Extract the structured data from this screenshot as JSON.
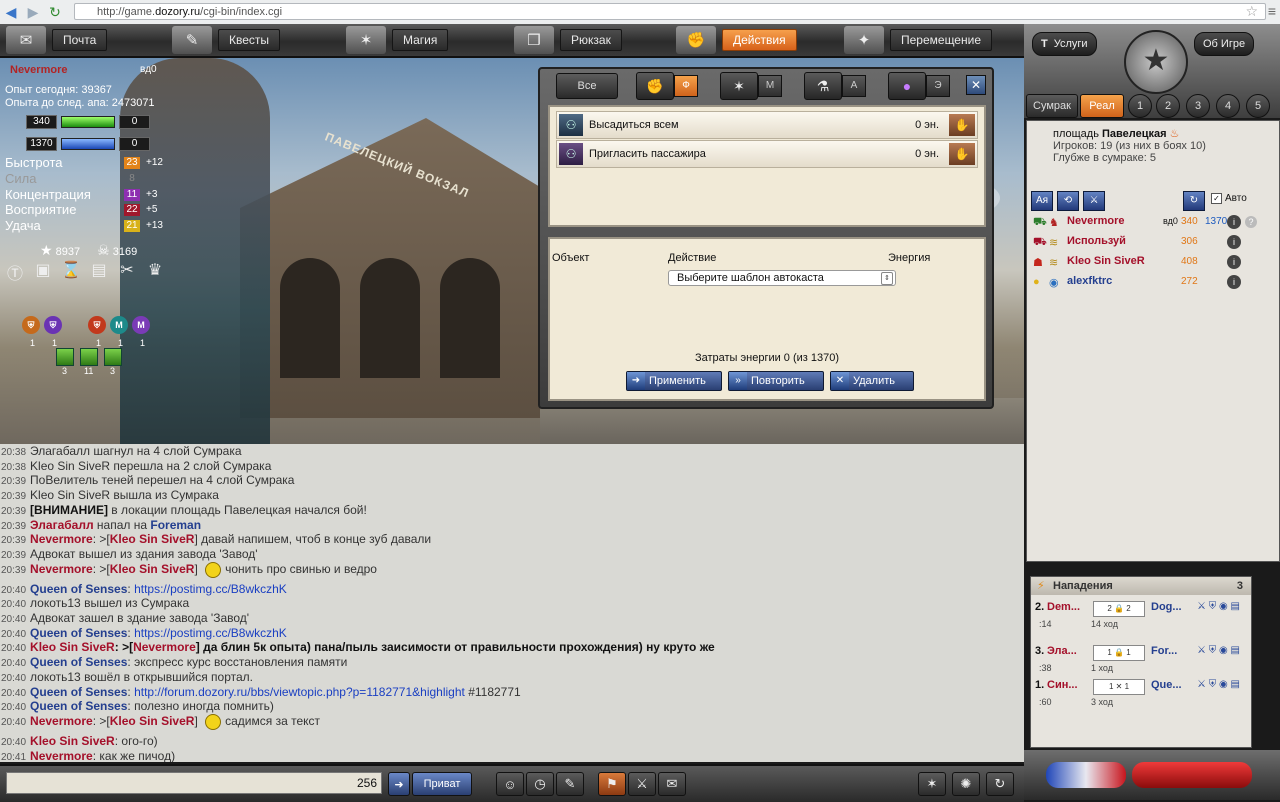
{
  "browser": {
    "url_prefix": "http://game.",
    "url_domain": "dozory.ru",
    "url_path": "/cgi-bin/index.cgi"
  },
  "topmenu": [
    {
      "label": "Почта",
      "icon": "mail-icon"
    },
    {
      "label": "Квесты",
      "icon": "quill-icon"
    },
    {
      "label": "Магия",
      "icon": "magic-icon"
    },
    {
      "label": "Рюкзак",
      "icon": "backpack-icon"
    },
    {
      "label": "Действия",
      "icon": "fist-icon",
      "active": true
    },
    {
      "label": "Перемещение",
      "icon": "compass-icon"
    }
  ],
  "player": {
    "name": "Nevermore",
    "level": "вд0",
    "exp_today": "Опыт сегодня: 39367",
    "exp_next": "Опыта до след. апа: 2473071",
    "hp": "340",
    "hp_extra": "0",
    "mp": "1370",
    "mp_extra": "0",
    "stats": [
      {
        "label": "Быстрота",
        "value": "23",
        "bonus": "+12",
        "color": "#e3841a"
      },
      {
        "label": "Сила",
        "value": "8",
        "bonus": "",
        "color": "#555555",
        "dim": true
      },
      {
        "label": "Концентрация",
        "value": "11",
        "bonus": "+3",
        "color": "#8e2fb1"
      },
      {
        "label": "Восприятие",
        "value": "22",
        "bonus": "+5",
        "color": "#a0182c"
      },
      {
        "label": "Удача",
        "value": "21",
        "bonus": "+13",
        "color": "#d8b21a"
      }
    ],
    "stars": "8937",
    "skulls": "3169",
    "badge_counts": [
      "1",
      "1",
      "1",
      "1",
      "1"
    ],
    "square_counts": [
      "3",
      "11",
      "3"
    ]
  },
  "scene": {
    "sign": "ПАВЕЛЕЦКИЙ ВОКЗАЛ"
  },
  "dialog": {
    "tab_all": "Все",
    "tabs": [
      {
        "icon": "fist-icon",
        "letter": "Ф",
        "active": true
      },
      {
        "icon": "magic-icon",
        "letter": "М"
      },
      {
        "icon": "potion-icon",
        "letter": "А"
      },
      {
        "icon": "orb-icon",
        "letter": "Э"
      }
    ],
    "actions": [
      {
        "label": "Высадиться всем",
        "energy": "0 эн."
      },
      {
        "label": "Пригласить пассажира",
        "energy": "0 эн."
      }
    ],
    "col_object": "Объект",
    "col_action": "Действие",
    "col_energy": "Энергия",
    "select_value": "Выберите шаблон автокаста",
    "energy_cost": "Затраты энергии 0 (из 1370)",
    "buttons": {
      "apply": "Применить",
      "repeat": "Повторить",
      "delete": "Удалить"
    }
  },
  "chat": [
    {
      "time": "20:38",
      "parts": [
        {
          "t": "Элагабалл шагнул на 4 слой Сумрака"
        }
      ]
    },
    {
      "time": "20:38",
      "parts": [
        {
          "t": "Kleo Sin SiveR перешла на 2 слой Сумрака"
        }
      ]
    },
    {
      "time": "20:39",
      "parts": [
        {
          "t": "ПоВелитель теней перешел на 4 слой Сумрака"
        }
      ]
    },
    {
      "time": "20:39",
      "parts": [
        {
          "t": "Kleo Sin SiveR вышла из Сумрака"
        }
      ]
    },
    {
      "time": "20:39",
      "parts": [
        {
          "t": "[ВНИМАНИЕ]",
          "c": "bold"
        },
        {
          "t": " в локации площадь Павелецкая начался бой!"
        }
      ]
    },
    {
      "time": "20:39",
      "parts": [
        {
          "t": "Элагабалл",
          "c": "nm-r"
        },
        {
          "t": " напал на "
        },
        {
          "t": "Foreman",
          "c": "nm-b"
        }
      ]
    },
    {
      "time": "20:39",
      "parts": [
        {
          "t": "Nevermore",
          "c": "nm-r"
        },
        {
          "t": ": >["
        },
        {
          "t": "Kleo Sin SiveR",
          "c": "nm-r"
        },
        {
          "t": "]  давай напишем, чтоб в конце зуб давали"
        }
      ]
    },
    {
      "time": "20:39",
      "parts": [
        {
          "t": "Адвокат вышел из здания завода 'Завод'"
        }
      ]
    },
    {
      "time": "20:39",
      "parts": [
        {
          "t": "Nevermore",
          "c": "nm-r"
        },
        {
          "t": ": >["
        },
        {
          "t": "Kleo Sin SiveR",
          "c": "nm-r"
        },
        {
          "t": "] "
        },
        {
          "t": "",
          "c": "smile"
        },
        {
          "t": "чонить про свинью и ведро"
        }
      ]
    },
    {
      "time": "20:40",
      "parts": [
        {
          "t": "Queen of Senses",
          "c": "nm-b"
        },
        {
          "t": ":  "
        },
        {
          "t": "https://postimg.cc/B8wkczhK",
          "c": "link"
        }
      ]
    },
    {
      "time": "20:40",
      "parts": [
        {
          "t": "локоть13 вышел из Сумрака"
        }
      ]
    },
    {
      "time": "20:40",
      "parts": [
        {
          "t": "Адвокат зашел в здание завода 'Завод'"
        }
      ]
    },
    {
      "time": "20:40",
      "parts": [
        {
          "t": "Queen of Senses",
          "c": "nm-b"
        },
        {
          "t": ":  "
        },
        {
          "t": "https://postimg.cc/B8wkczhK",
          "c": "link"
        }
      ]
    },
    {
      "time": "20:40",
      "parts": [
        {
          "t": "Kleo Sin SiveR",
          "c": "nm-r"
        },
        {
          "t": ": >[",
          "c": "bold"
        },
        {
          "t": "Nevermore",
          "c": "nm-r"
        },
        {
          "t": "]  да блин 5к опыта) пана/пыль заисимости от правильности прохождения) ну круто же",
          "c": "bold"
        }
      ]
    },
    {
      "time": "20:40",
      "parts": [
        {
          "t": "Queen of Senses",
          "c": "nm-b"
        },
        {
          "t": ":  экспресс курс восстановления памяти"
        }
      ]
    },
    {
      "time": "20:40",
      "parts": [
        {
          "t": "локоть13 вошёл в открывшийся портал."
        }
      ]
    },
    {
      "time": "20:40",
      "parts": [
        {
          "t": "Queen of Senses",
          "c": "nm-b"
        },
        {
          "t": ":  "
        },
        {
          "t": "http://forum.dozory.ru/bbs/viewtopic.php?p=1182771&highlight",
          "c": "link"
        },
        {
          "t": " #1182771"
        }
      ]
    },
    {
      "time": "20:40",
      "parts": [
        {
          "t": "Queen of Senses",
          "c": "nm-b"
        },
        {
          "t": ":  полезно иногда помнить)"
        }
      ]
    },
    {
      "time": "20:40",
      "parts": [
        {
          "t": "Nevermore",
          "c": "nm-r"
        },
        {
          "t": ": >["
        },
        {
          "t": "Kleo Sin SiveR",
          "c": "nm-r"
        },
        {
          "t": "] "
        },
        {
          "t": "",
          "c": "smile"
        },
        {
          "t": "садимся за текст"
        }
      ]
    },
    {
      "time": "20:40",
      "parts": [
        {
          "t": "Kleo Sin SiveR",
          "c": "nm-r"
        },
        {
          "t": ":  ого-го)"
        }
      ]
    },
    {
      "time": "20:41",
      "parts": [
        {
          "t": "Nevermore",
          "c": "nm-r"
        },
        {
          "t": ":  как же пичод)"
        }
      ]
    }
  ],
  "bottom": {
    "char_counter": "256",
    "private_label": "Приват"
  },
  "right": {
    "services": "Услуги",
    "about": "Об Игре",
    "tabs": [
      "Сумрак",
      "Реал",
      "1",
      "2",
      "3",
      "4",
      "5"
    ],
    "location_prefix": "площадь ",
    "location_name": "Павелецкая",
    "players_line": "Игроков: 19 (из них в боях 10)",
    "depth_line": "Глубже в сумраке: 5",
    "auto_label": "Авто",
    "players": [
      {
        "name": "Nevermore",
        "color": "#a4102a",
        "level": "вд0",
        "hp": "340",
        "mp": "1370"
      },
      {
        "name": "Используй",
        "color": "#a4102a",
        "level": "",
        "hp": "306",
        "mp": ""
      },
      {
        "name": "Kleo Sin SiveR",
        "color": "#a4102a",
        "level": "",
        "hp": "408",
        "mp": ""
      },
      {
        "name": "alexfktrc",
        "color": "#243f8f",
        "level": "",
        "hp": "272",
        "mp": ""
      }
    ],
    "attacks_label": "Нападения",
    "attacks_count": "3",
    "attacks": [
      {
        "rank": "2.",
        "attacker": "Dem...",
        "attacker_color": "#a4102a",
        "box": "2  🔒  2",
        "defender": "Dog...",
        "defender_color": "#243f8f",
        "time": ":14",
        "moves": "14 ход"
      },
      {
        "rank": "3.",
        "attacker": "Эла...",
        "attacker_color": "#a4102a",
        "box": "1  🔒  1",
        "defender": "For...",
        "defender_color": "#243f8f",
        "time": ":38",
        "moves": "1 ход"
      },
      {
        "rank": "1.",
        "attacker": "Син...",
        "attacker_color": "#a4102a",
        "box": "1  ✕  1",
        "defender": "Que...",
        "defender_color": "#243f8f",
        "time": ":60",
        "moves": "3 ход"
      }
    ]
  }
}
